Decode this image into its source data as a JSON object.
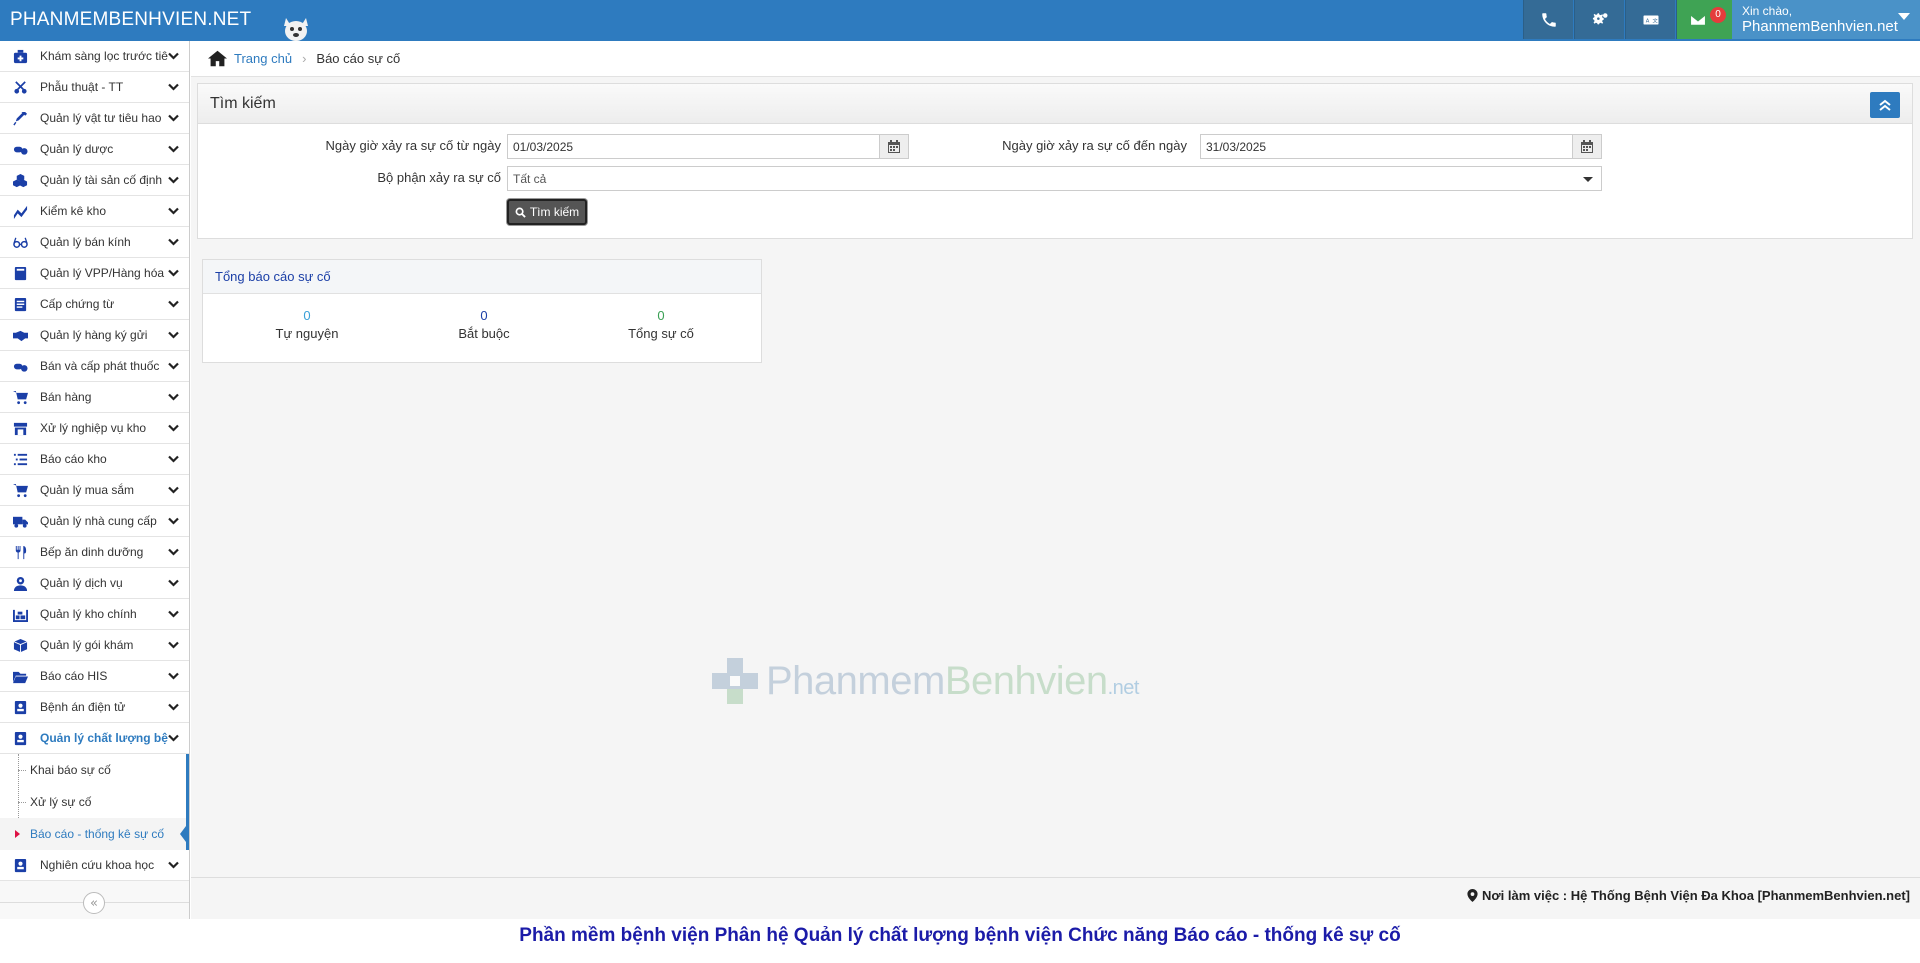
{
  "topbar": {
    "brand": "PHANMEMBENHVIEN.NET",
    "greeting": "Xin chào,",
    "username": "PhanmemBenhvien.net",
    "mail_count": "0",
    "accent": "#2e7bbf"
  },
  "sidebar": {
    "items": [
      {
        "label": "Khám sàng lọc trước tiêm",
        "icon": "medical-kit-icon"
      },
      {
        "label": "Phẫu thuật - TT",
        "icon": "scissors-icon"
      },
      {
        "label": "Quản lý vật tư tiêu hao",
        "icon": "syringe-icon"
      },
      {
        "label": "Quản lý dược",
        "icon": "pills-icon"
      },
      {
        "label": "Quản lý tài sản cố định",
        "icon": "cubes-icon"
      },
      {
        "label": "Kiểm kê kho",
        "icon": "inventory-icon"
      },
      {
        "label": "Quản lý bán kính",
        "icon": "glasses-icon"
      },
      {
        "label": "Quản lý VPP/Hàng hóa",
        "icon": "book-icon"
      },
      {
        "label": "Cấp chứng từ",
        "icon": "document-icon"
      },
      {
        "label": "Quản lý hàng ký gửi",
        "icon": "handshake-icon"
      },
      {
        "label": "Bán và cấp phát thuốc",
        "icon": "pills-icon"
      },
      {
        "label": "Bán hàng",
        "icon": "cart-icon"
      },
      {
        "label": "Xử lý nghiệp vụ kho",
        "icon": "store-icon"
      },
      {
        "label": "Báo cáo kho",
        "icon": "list-icon"
      },
      {
        "label": "Quản lý mua sắm",
        "icon": "cart-icon"
      },
      {
        "label": "Quản lý nhà cung cấp",
        "icon": "truck-icon"
      },
      {
        "label": "Bếp ăn dinh dưỡng",
        "icon": "utensils-icon"
      },
      {
        "label": "Quản lý dịch vụ",
        "icon": "user-doctor-icon"
      },
      {
        "label": "Quản lý kho chính",
        "icon": "warehouse-icon"
      },
      {
        "label": "Quản lý gói khám",
        "icon": "box-icon"
      },
      {
        "label": "Báo cáo HIS",
        "icon": "folder-open-icon"
      },
      {
        "label": "Bệnh án điện tử",
        "icon": "id-card-icon"
      }
    ],
    "active_item": {
      "label": "Quản lý chất lượng bệnh viện",
      "icon": "id-card-icon"
    },
    "sub_items": [
      {
        "label": "Khai báo sự cố"
      },
      {
        "label": "Xử lý sự cố"
      },
      {
        "label": "Báo cáo - thống kê sự cố"
      }
    ],
    "last_item": {
      "label": "Nghiên cứu khoa học",
      "icon": "id-card-icon"
    },
    "collapse_label": "«"
  },
  "breadcrumb": {
    "home": "Trang chủ",
    "separator": "›",
    "current": "Báo cáo sự cố"
  },
  "search": {
    "title": "Tìm kiếm",
    "from_label": "Ngày giờ xảy ra sự cố từ ngày",
    "from_value": "01/03/2025",
    "to_label": "Ngày giờ xảy ra sự cố đến ngày",
    "to_value": "31/03/2025",
    "dept_label": "Bộ phận xảy ra sự cố",
    "dept_value": "Tất cả",
    "button": "Tìm kiếm"
  },
  "summary": {
    "title": "Tổng báo cáo sự cố",
    "stats": [
      {
        "value": "0",
        "label": "Tự nguyện",
        "color": "#3aa0d8"
      },
      {
        "value": "0",
        "label": "Bắt buộc",
        "color": "#1b3fa7"
      },
      {
        "value": "0",
        "label": "Tổng sự cố",
        "color": "#3aa054"
      }
    ]
  },
  "watermark": {
    "part1": "Phanmem",
    "part2": "Benhvien",
    "part3": ".net"
  },
  "footer": {
    "workplace": "Nơi làm việc : Hệ Thống Bệnh Viện Đa Khoa [PhanmemBenhvien.net]"
  },
  "caption": "Phần mềm bệnh viện Phân hệ Quản lý chất lượng bệnh viện Chức năng Báo cáo - thống kê sự cố"
}
